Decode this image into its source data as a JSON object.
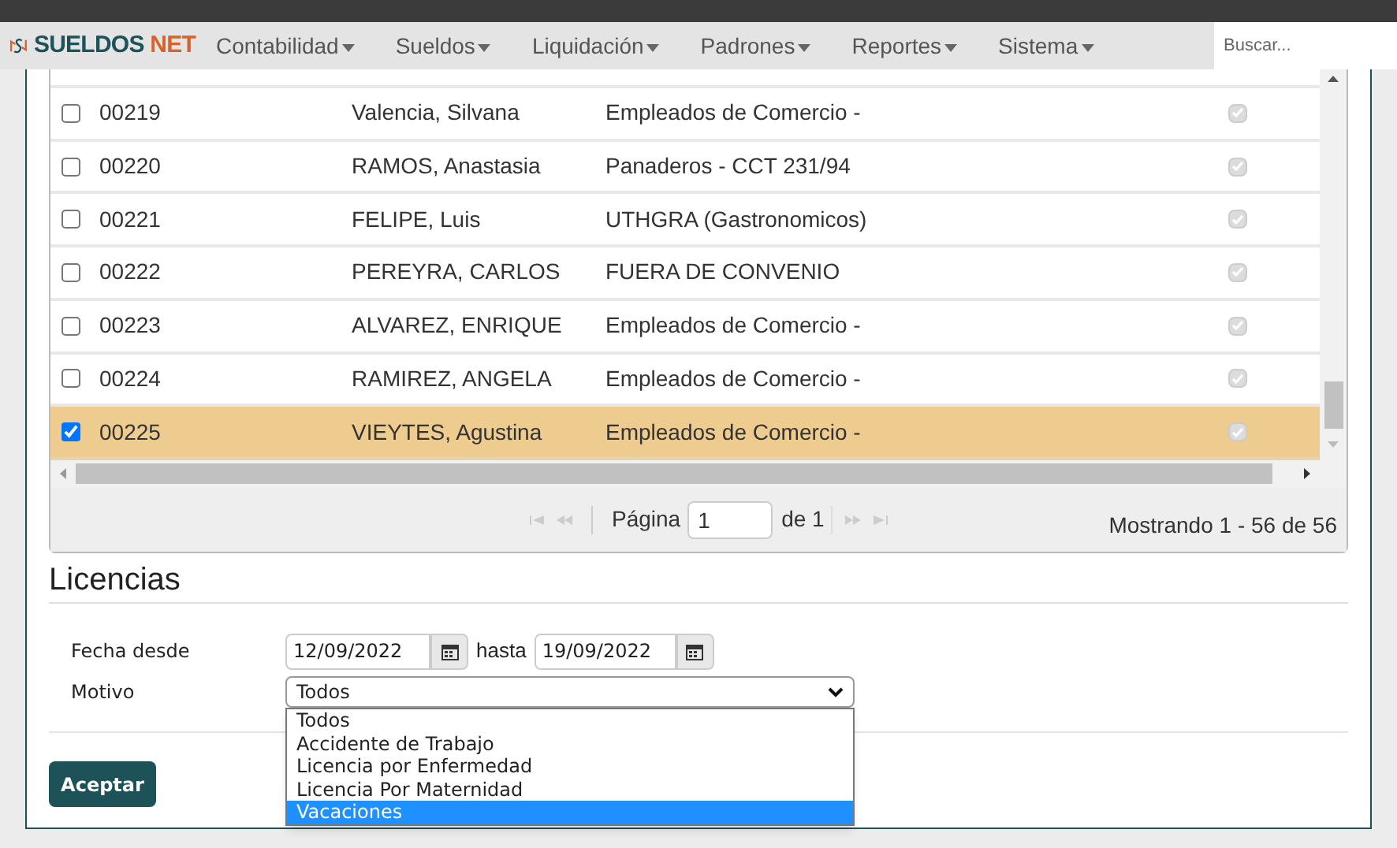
{
  "brand": {
    "first": "SUELDOS",
    "second": "NET"
  },
  "menu": [
    {
      "label": "Contabilidad"
    },
    {
      "label": "Sueldos"
    },
    {
      "label": "Liquidación"
    },
    {
      "label": "Padrones"
    },
    {
      "label": "Reportes"
    },
    {
      "label": "Sistema"
    }
  ],
  "search": {
    "placeholder": "Buscar..."
  },
  "table": {
    "rows": [
      {
        "code": "00219",
        "name": "Valencia, Silvana",
        "convenio": "Empleados de Comercio -",
        "selected": false,
        "active": true
      },
      {
        "code": "00220",
        "name": "RAMOS, Anastasia",
        "convenio": "Panaderos - CCT 231/94",
        "selected": false,
        "active": true
      },
      {
        "code": "00221",
        "name": "FELIPE, Luis",
        "convenio": "UTHGRA (Gastronomicos)",
        "selected": false,
        "active": true
      },
      {
        "code": "00222",
        "name": "PEREYRA, CARLOS",
        "convenio": "FUERA DE CONVENIO",
        "selected": false,
        "active": true
      },
      {
        "code": "00223",
        "name": "ALVAREZ, ENRIQUE",
        "convenio": "Empleados de Comercio -",
        "selected": false,
        "active": true
      },
      {
        "code": "00224",
        "name": "RAMIREZ, ANGELA",
        "convenio": "Empleados de Comercio -",
        "selected": false,
        "active": true
      },
      {
        "code": "00225",
        "name": "VIEYTES, Agustina",
        "convenio": "Empleados de Comercio -",
        "selected": true,
        "active": true
      }
    ]
  },
  "pager": {
    "page_label": "Página",
    "page": "1",
    "of": "de 1",
    "summary": "Mostrando 1 - 56 de 56"
  },
  "licencias": {
    "title": "Licencias",
    "date_label": "Fecha desde",
    "from": "12/09/2022",
    "to_label": "hasta",
    "to": "19/09/2022",
    "motivo_label": "Motivo",
    "motivo_value": "Todos",
    "options": [
      {
        "label": "Todos",
        "selected": false
      },
      {
        "label": "Accidente de Trabajo",
        "selected": false
      },
      {
        "label": "Licencia por Enfermedad",
        "selected": false
      },
      {
        "label": "Licencia Por Maternidad",
        "selected": false
      },
      {
        "label": "Vacaciones",
        "selected": true
      }
    ]
  },
  "accept_button": "Aceptar"
}
